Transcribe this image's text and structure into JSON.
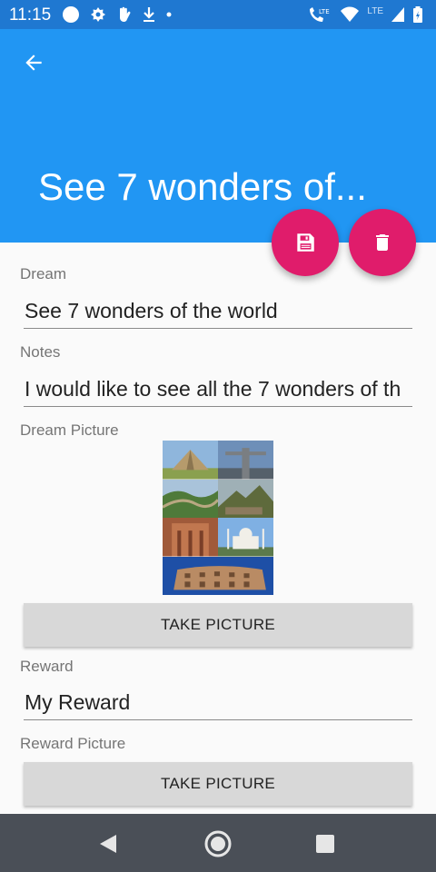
{
  "status_bar": {
    "time": "11:15",
    "network_label": "LTE",
    "wifi_label": "LTE"
  },
  "app_bar": {
    "title": "See 7 wonders of..."
  },
  "form": {
    "dream_label": "Dream",
    "dream_value": "See 7 wonders of the world",
    "notes_label": "Notes",
    "notes_value": "I would like to see all the 7 wonders of th",
    "dream_picture_label": "Dream Picture",
    "take_picture_label_1": "TAKE PICTURE",
    "reward_label": "Reward",
    "reward_value": "My Reward",
    "reward_picture_label": "Reward Picture",
    "take_picture_label_2": "TAKE PICTURE"
  },
  "colors": {
    "primary": "#2196f3",
    "primary_dark": "#1f78d1",
    "accent": "#e01c6b",
    "nav_bar": "#4a4f57"
  },
  "icons": {
    "back": "arrow-left-icon",
    "save": "floppy-disk-icon",
    "delete": "trash-icon"
  }
}
